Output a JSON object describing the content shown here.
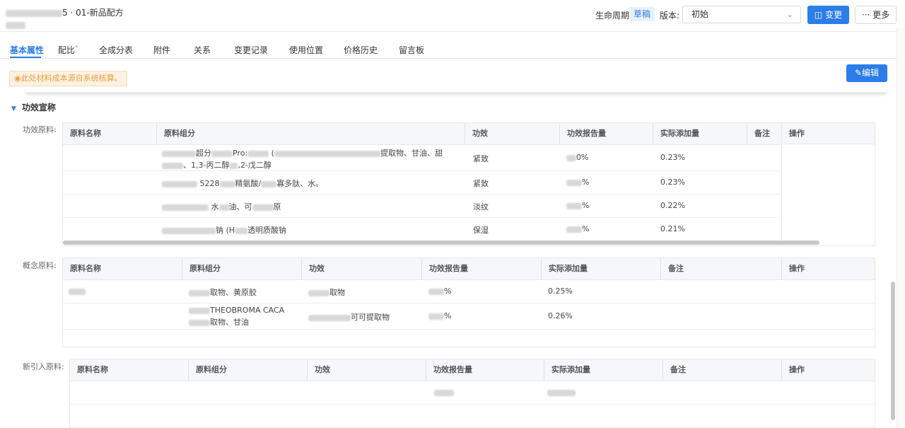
{
  "header": {
    "title_suffix": "5 · 01-新品配方",
    "lifecycle_label": "生命周期:",
    "lifecycle_value": "草稿",
    "version_label": "版本:",
    "version_value": "初始",
    "change_button": "变更",
    "more_button": "更多",
    "accent": "#2b7de9"
  },
  "tabs": [
    "基本属性",
    "配比",
    "全成分表",
    "附件",
    "关系",
    "变更记录",
    "使用位置",
    "价格历史",
    "留言板"
  ],
  "notice": "此处材料成本源自系统核算。",
  "edit_button": "编辑",
  "section_title": "功效宣称",
  "efficacy": {
    "label": "功效原料:",
    "headers": [
      "原料名称",
      "原料组分",
      "功效",
      "功效报告量",
      "实际添加量",
      "备注",
      "操作"
    ],
    "rows": [
      {
        "comp1": "超分",
        "comp2": "Pro:",
        "comp3": "提取物、甘油、甜",
        "comp4": "1,3-丙二醇",
        "comp5": ",2-戊二醇",
        "effect": "紧致",
        "report": "0%",
        "actual": "0.23%"
      },
      {
        "comp1": "5228",
        "comp2": "精氨酸/",
        "comp3": "寡多肽、水。",
        "effect": "紧致",
        "report": "%",
        "actual": "0.23%"
      },
      {
        "comp1": "水",
        "comp2": "油、可",
        "comp3": "原",
        "effect": "淡纹",
        "report": "%",
        "actual": "0.22%"
      },
      {
        "comp1": "钠 (H",
        "comp2": "透明质酸钠",
        "effect": "保湿",
        "report": "%",
        "actual": "0.21%"
      }
    ]
  },
  "concept": {
    "label": "概念原料:",
    "headers": [
      "原料名称",
      "原料组分",
      "功效",
      "功效报告量",
      "实际添加量",
      "备注",
      "操作"
    ],
    "rows": [
      {
        "comp": "取物、黄原胶",
        "effect": "取物",
        "report": "%",
        "actual": "0.25%"
      },
      {
        "comp1": "THEOBROMA CACA",
        "comp2": "取物、甘油",
        "effect": "可可提取物",
        "report": "%",
        "actual": "0.26%"
      }
    ]
  },
  "newly": {
    "label": "新引入原料:",
    "headers": [
      "原料名称",
      "原料组分",
      "功效",
      "功效报告量",
      "实际添加量",
      "备注",
      "操作"
    ]
  }
}
